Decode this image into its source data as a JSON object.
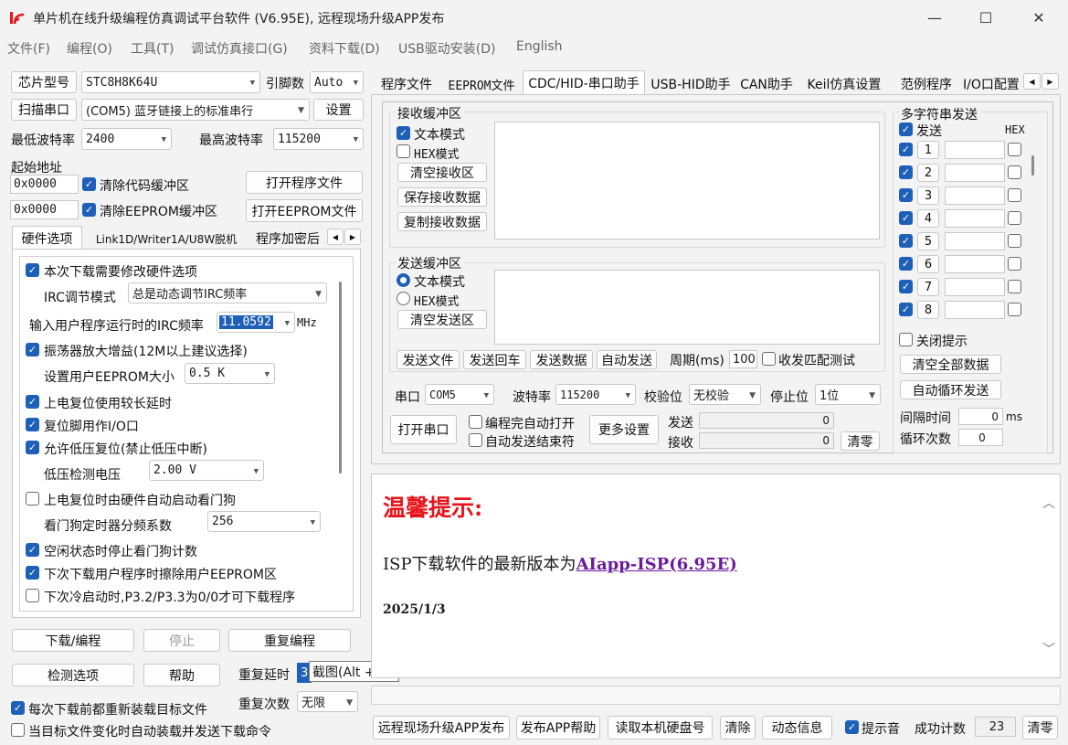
{
  "window": {
    "title": "单片机在线升级编程仿真调试平台软件 (V6.95E), 远程现场升级APP发布",
    "min": "—",
    "max": "☐",
    "close": "✕"
  },
  "menu": [
    "文件(F)",
    "编程(O)",
    "工具(T)",
    "调试仿真接口(G)",
    "资料下载(D)",
    "USB驱动安装(D)",
    "English"
  ],
  "left": {
    "chip_label": "芯片型号",
    "chip_value": "STC8H8K64U",
    "pins_label": "引脚数",
    "pins_value": "Auto",
    "scan_label": "扫描串口",
    "port_value": "(COM5) 蓝牙链接上的标准串行",
    "settings": "设置",
    "min_baud_label": "最低波特率",
    "min_baud": "2400",
    "max_baud_label": "最高波特率",
    "max_baud": "115200",
    "start_addr_label": "起始地址",
    "addr1": "0x0000",
    "clear_code": "清除代码缓冲区",
    "open_prog": "打开程序文件",
    "addr2": "0x0000",
    "clear_eeprom": "清除EEPROM缓冲区",
    "open_eeprom": "打开EEPROM文件",
    "tabs": [
      "硬件选项",
      "Link1D/Writer1A/U8W脱机",
      "程序加密后"
    ],
    "hw": {
      "opt1": "本次下载需要修改硬件选项",
      "irc_mode_label": "IRC调节模式",
      "irc_mode_value": "总是动态调节IRC频率",
      "irc_freq_label": "输入用户程序运行时的IRC频率",
      "irc_freq_value": "11.0592",
      "mhz": "MHz",
      "opt2": "振荡器放大增益(12M以上建议选择)",
      "eeprom_size_label": "设置用户EEPROM大小",
      "eeprom_size": "0.5 K",
      "opt3": "上电复位使用较长延时",
      "opt4": "复位脚用作I/O口",
      "opt5": "允许低压复位(禁止低压中断)",
      "lvd_label": "低压检测电压",
      "lvd_value": "2.00 V",
      "opt6": "上电复位时由硬件自动启动看门狗",
      "wdt_label": "看门狗定时器分频系数",
      "wdt_value": "256",
      "opt7": "空闲状态时停止看门狗计数",
      "opt8": "下次下载用户程序时擦除用户EEPROM区",
      "opt9": "下次冷启动时,P3.2/P3.3为0/0才可下载程序"
    },
    "download": "下载/编程",
    "stop": "停止",
    "repeat_prog": "重复编程",
    "check_opt": "检测选项",
    "help": "帮助",
    "repeat_delay_label": "重复延时",
    "repeat_delay": "3",
    "repeat_count_label": "重复次数",
    "repeat_count": "无限",
    "reload_label": "每次下载前都重新装载目标文件",
    "auto_label": "当目标文件变化时自动装载并发送下载命令"
  },
  "tooltip": "截图(Alt + A)",
  "right": {
    "tabs": [
      "程序文件",
      "EEPROM文件",
      "CDC/HID-串口助手",
      "USB-HID助手",
      "CAN助手",
      "Keil仿真设置",
      "范例程序",
      "I/O口配置"
    ],
    "recv": {
      "title": "接收缓冲区",
      "text_mode": "文本模式",
      "hex_mode": "HEX模式",
      "clear": "清空接收区",
      "save": "保存接收数据",
      "copy": "复制接收数据"
    },
    "send": {
      "title": "发送缓冲区",
      "text_mode": "文本模式",
      "hex_mode": "HEX模式",
      "clear": "清空发送区",
      "send_file": "发送文件",
      "send_cr": "发送回车",
      "send_data": "发送数据",
      "auto_send": "自动发送",
      "period_label": "周期(ms)",
      "period": "100",
      "match_test": "收发匹配测试"
    },
    "serial": {
      "port_label": "串口",
      "port": "COM5",
      "baud_label": "波特率",
      "baud": "115200",
      "parity_label": "校验位",
      "parity": "无校验",
      "stop_label": "停止位",
      "stop": "1位",
      "open": "打开串口",
      "auto_open": "编程完自动打开",
      "auto_send_end": "自动发送结束符",
      "more": "更多设置",
      "tx_label": "发送",
      "tx": "0",
      "rx_label": "接收",
      "rx": "0",
      "clear": "清零"
    },
    "multi": {
      "title": "多字符串发送",
      "send": "发送",
      "hex": "HEX",
      "rows": [
        "1",
        "2",
        "3",
        "4",
        "5",
        "6",
        "7",
        "8"
      ],
      "close_tip": "关闭提示",
      "clear_all": "清空全部数据",
      "auto_loop": "自动循环发送",
      "interval_label": "间隔时间",
      "interval": "0",
      "ms": "ms",
      "loop_label": "循环次数",
      "loop": "0"
    },
    "info": {
      "heading": "温馨提示:",
      "line_prefix": "ISP下载软件的最新版本为",
      "link": "AIapp-ISP(6.95E)",
      "date": "2025/1/3"
    },
    "bottom": {
      "remote": "远程现场升级APP发布",
      "app_help": "发布APP帮助",
      "read_hdd": "读取本机硬盘号",
      "clear": "清除",
      "dyn_info": "动态信息",
      "beep": "提示音",
      "count_label": "成功计数",
      "count": "23",
      "clear2": "清零"
    }
  },
  "colors": {
    "accent": "#1e5fb8",
    "heading": "#e8141b",
    "link": "#6a1b9a"
  }
}
